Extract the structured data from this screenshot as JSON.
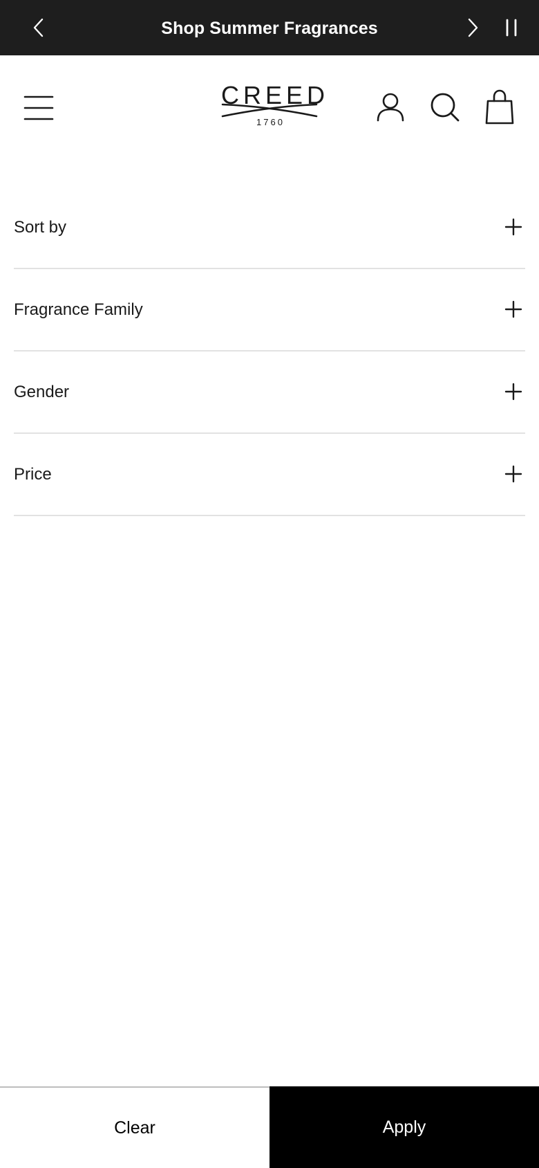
{
  "promo": {
    "text": "Shop Summer Fragrances",
    "prev_icon": "chevron-left-icon",
    "next_icon": "chevron-right-icon",
    "pause_icon": "pause-icon"
  },
  "header": {
    "logo": {
      "wordmark": "CREED",
      "year": "1760"
    },
    "icons": {
      "menu": "hamburger-menu-icon",
      "account": "user-icon",
      "search": "search-icon",
      "bag": "shopping-bag-icon"
    }
  },
  "filters": {
    "items": [
      {
        "label": "Sort by",
        "icon": "plus-icon"
      },
      {
        "label": "Fragrance Family",
        "icon": "plus-icon"
      },
      {
        "label": "Gender",
        "icon": "plus-icon"
      },
      {
        "label": "Price",
        "icon": "plus-icon"
      }
    ]
  },
  "actions": {
    "clear_label": "Clear",
    "apply_label": "Apply"
  },
  "colors": {
    "promo_bg": "#1e1e1e",
    "apply_bg": "#000000",
    "divider": "#e2e2e2",
    "text": "#1a1a1a"
  }
}
